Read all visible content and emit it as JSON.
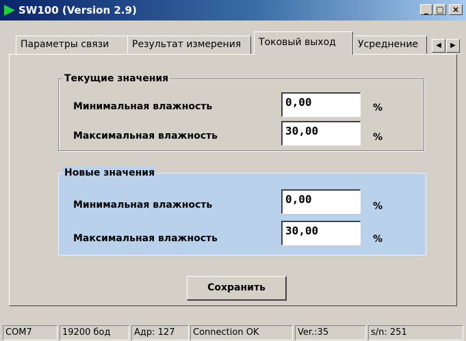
{
  "window": {
    "title": "SW100 (Version 2.9)",
    "controls": {
      "minimize": "_",
      "maximize": "□",
      "close": "×"
    }
  },
  "tabs": [
    {
      "label": "Параметры связи",
      "active": false
    },
    {
      "label": "Результат измерения",
      "active": false
    },
    {
      "label": "Токовый выход",
      "active": true
    },
    {
      "label": "Усреднение",
      "active": false
    }
  ],
  "tab_scroll": {
    "left": "◀",
    "right": "▶"
  },
  "current_values": {
    "title": "Текущие значения",
    "min_label": "Минимальная влажность",
    "min_value": "0,00",
    "min_unit": "%",
    "max_label": "Максимальная влажность",
    "max_value": "30,00",
    "max_unit": "%"
  },
  "new_values": {
    "title": "Новые значения",
    "min_label": "Минимальная влажность",
    "min_value": "0,00",
    "min_unit": "%",
    "max_label": "Максимальная влажность",
    "max_value": "30,00",
    "max_unit": "%"
  },
  "save_button": "Сохранить",
  "status": {
    "port": "COM7",
    "baud": "19200 бод",
    "address": "Адр: 127",
    "connection": "Connection OK",
    "version": "Ver.:35",
    "serial": "s/n: 251"
  },
  "colors": {
    "title_bar_start": "#0a246a",
    "title_bar_end": "#a6caf0",
    "new_values_bg": "#b9d1ea",
    "window_bg": "#d4d0c8"
  }
}
